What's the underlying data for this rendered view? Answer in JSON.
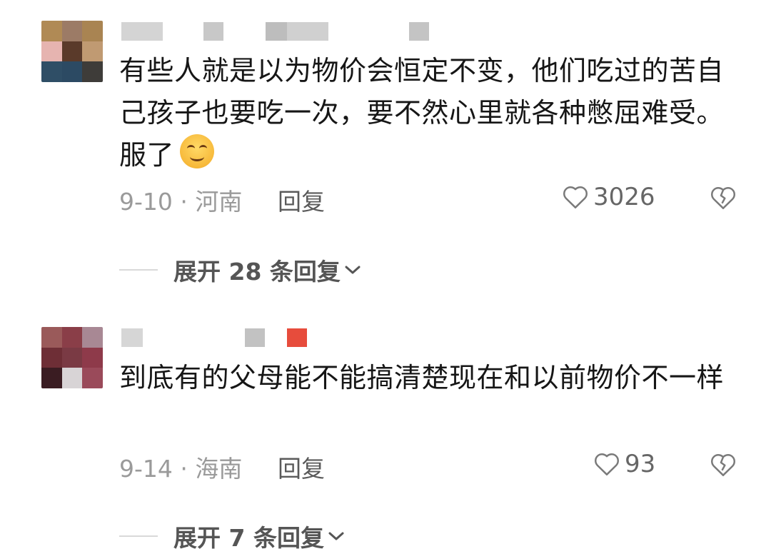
{
  "comments": [
    {
      "avatar_colors": [
        "#b08a55",
        "#9c7b66",
        "#a98452",
        "#e6b4b0",
        "#5a3a2a",
        "#c09a72",
        "#2f4e66",
        "#2c4a63",
        "#3e3c39"
      ],
      "name_blocks": [
        "#d4d4d4",
        "#c8c8c8",
        "#bdbdbd",
        "#d0d0d0",
        "#c4c4c4"
      ],
      "text": "有些人就是以为物价会恒定不变，他们吃过的苦自己孩子也要吃一次，要不然心里就各种憋屈难受。服了",
      "emoji_icon": "smiling-face-emoji",
      "date_location": "9-10 · 河南",
      "reply_label": "回复",
      "like_count": "3026",
      "expand_label": "展开 28 条回复"
    },
    {
      "avatar_colors": [
        "#9a5a5a",
        "#8a3e48",
        "#a88894",
        "#6e2e36",
        "#7a3a44",
        "#8e3a4a",
        "#3a1c22",
        "#d8d4d6",
        "#9a4a5a"
      ],
      "name_blocks": [
        "#d6d6d6",
        "#c2c2c2",
        "#e74c3c"
      ],
      "text": "到底有的父母能不能搞清楚现在和以前物价不一样",
      "date_location": "9-14 · 海南",
      "reply_label": "回复",
      "like_count": "93",
      "expand_label": "展开 7 条回复"
    }
  ],
  "icons": {
    "like": "heart-outline-icon",
    "dislike": "broken-heart-icon",
    "expand": "chevron-down-icon"
  }
}
